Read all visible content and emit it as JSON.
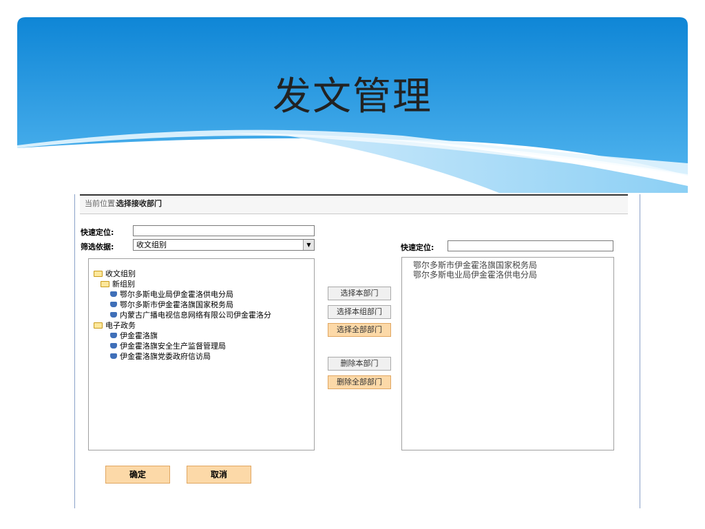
{
  "slide": {
    "title": "发文管理"
  },
  "breadcrumb": {
    "label": "当前位置:",
    "value": "选择接收部门"
  },
  "left": {
    "quick_locate_label": "快速定位:",
    "quick_locate_value": "",
    "filter_label": "筛选依据:",
    "filter_value": "收文组别"
  },
  "tree": {
    "root": "收文组别",
    "groups": [
      {
        "name": "新组别",
        "items": [
          "鄂尔多斯电业局伊金霍洛供电分局",
          "鄂尔多斯市伊金霍洛旗国家税务局",
          "内蒙古广播电视信息网络有限公司伊金霍洛分"
        ]
      },
      {
        "name": "电子政务",
        "items": [
          "伊金霍洛旗",
          "伊金霍洛旗安全生产监督管理局",
          "伊金霍洛旗党委政府信访局"
        ]
      }
    ]
  },
  "buttons": {
    "select_dept": "选择本部门",
    "select_group": "选择本组部门",
    "select_all": "选择全部部门",
    "delete_dept": "删除本部门",
    "delete_all": "删除全部部门",
    "ok": "确定",
    "cancel": "取消"
  },
  "right": {
    "quick_locate_label": "快速定位:",
    "quick_locate_value": "",
    "selected": [
      "鄂尔多斯市伊金霍洛旗国家税务局",
      "鄂尔多斯电业局伊金霍洛供电分局"
    ]
  },
  "colors": {
    "header_blue": "#1e8ed8",
    "button_orange": "#fcd9a8",
    "frame_blue": "#8aa1c8"
  }
}
